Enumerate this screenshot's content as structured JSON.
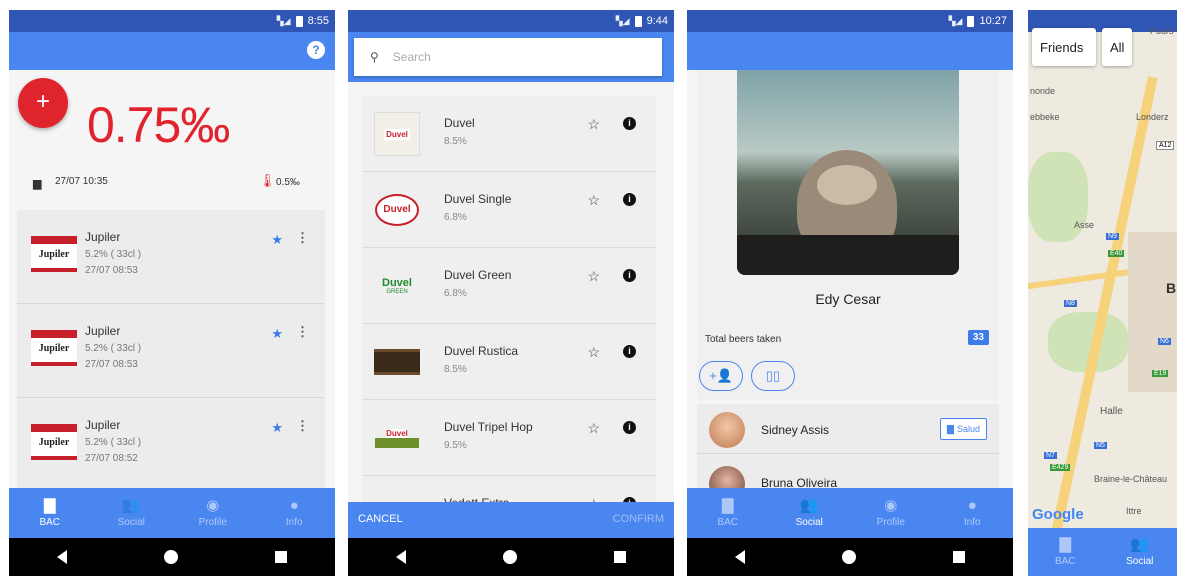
{
  "status_times": [
    "8:55",
    "9:44",
    "10:27"
  ],
  "bac_screen": {
    "reading": "0.75‰",
    "timestamp": "27/07 10:35",
    "limit": "0.5‰",
    "entries": [
      {
        "name": "Jupiler",
        "abv": "5.2% ( 33cl )",
        "time": "27/07 08:53",
        "logo_text": "Jupiler"
      },
      {
        "name": "Jupiler",
        "abv": "5.2% ( 33cl )",
        "time": "27/07 08:53",
        "logo_text": "Jupiler"
      },
      {
        "name": "Jupiler",
        "abv": "5.2% ( 33cl )",
        "time": "27/07 08:52",
        "logo_text": "Jupiler"
      }
    ]
  },
  "bottom_tabs": {
    "bac": "BAC",
    "social": "Social",
    "profile": "Profile",
    "info": "Info"
  },
  "search_screen": {
    "placeholder": "Search",
    "beers": [
      {
        "name": "Duvel",
        "abv": "8.5%",
        "logo": "Duvel"
      },
      {
        "name": "Duvel Single",
        "abv": "6.8%",
        "logo": "Duvel"
      },
      {
        "name": "Duvel Green",
        "abv": "6.8%",
        "logo": "Duvel"
      },
      {
        "name": "Duvel Rustica",
        "abv": "8.5%",
        "logo": ""
      },
      {
        "name": "Duvel Tripel Hop",
        "abv": "9.5%",
        "logo": "Duvel"
      },
      {
        "name": "Vedett Extra",
        "abv": "",
        "logo": ""
      }
    ],
    "cancel": "CANCEL",
    "confirm": "CONFIRM"
  },
  "profile_screen": {
    "name": "Edy Cesar",
    "total_label": "Total beers taken",
    "total_count": "33",
    "friends": [
      {
        "name": "Sidney Assis",
        "action": "Salud"
      },
      {
        "name": "Bruna Oliveira"
      }
    ]
  },
  "map_screen": {
    "filters": [
      "Friends",
      "All"
    ],
    "places": [
      "Puurs",
      "Londerz",
      "Asse",
      "B",
      "Halle",
      "Braine-le-Château",
      "Ittre",
      "nonde",
      "ebbeke"
    ],
    "road_labels": [
      "A12",
      "N9",
      "E40",
      "N8",
      "N6",
      "E19",
      "N7",
      "N5",
      "E429"
    ],
    "google": "Google"
  },
  "colors": {
    "primary": "#4a86f0",
    "status": "#3056b5",
    "accent_red": "#e0242d"
  }
}
